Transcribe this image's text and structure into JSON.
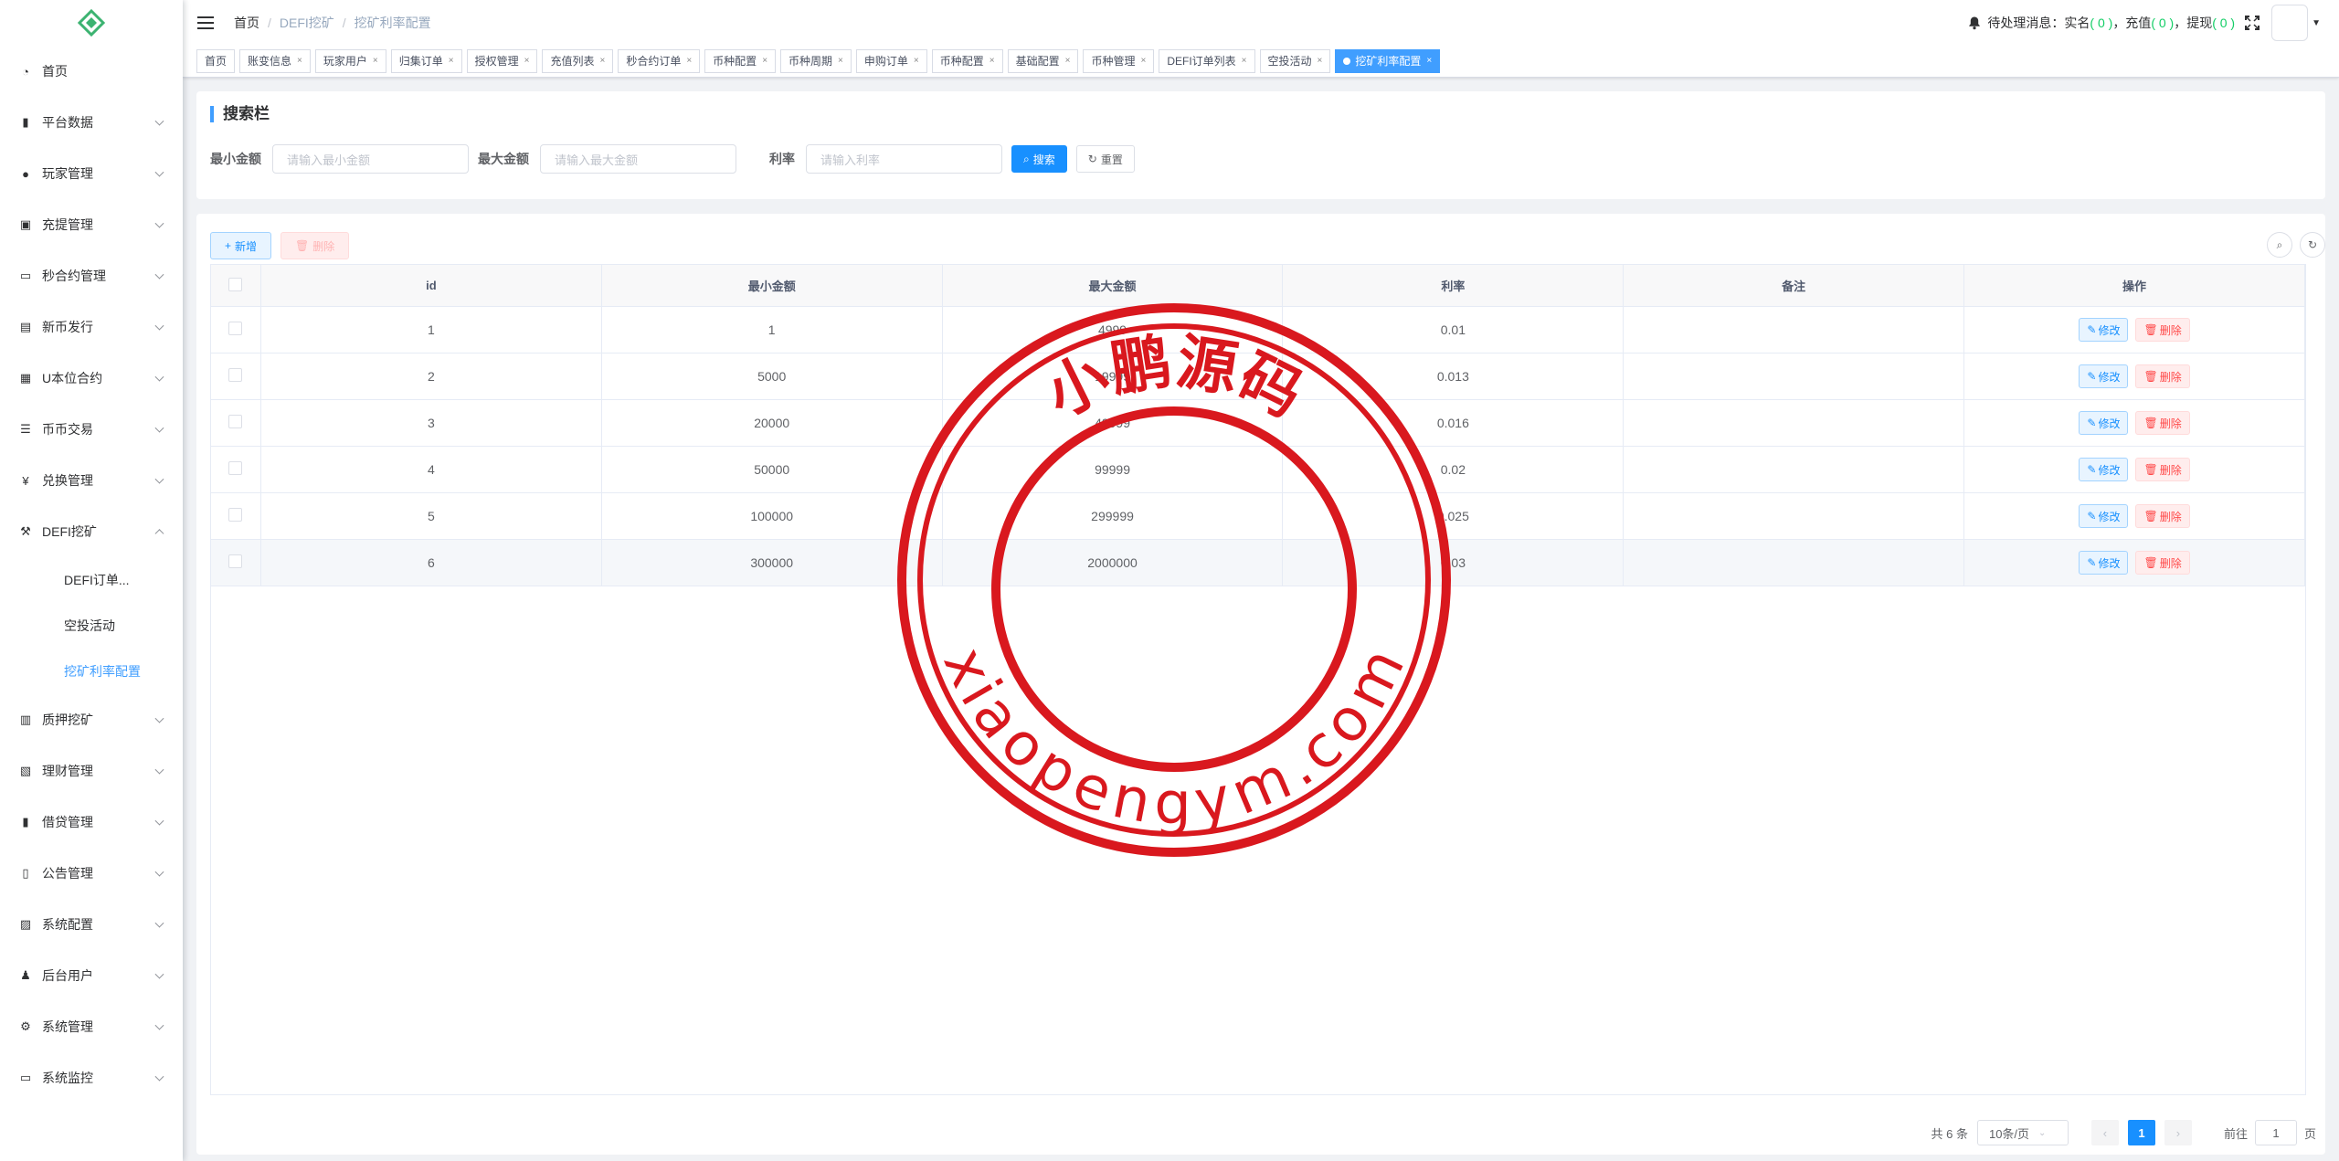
{
  "sidebar": {
    "items": [
      {
        "label": "首页",
        "icon": "dashboard-icon",
        "expandable": false
      },
      {
        "label": "平台数据",
        "icon": "chart-icon",
        "expandable": true
      },
      {
        "label": "玩家管理",
        "icon": "user-icon",
        "expandable": true
      },
      {
        "label": "充提管理",
        "icon": "wallet-icon",
        "expandable": true
      },
      {
        "label": "秒合约管理",
        "icon": "monitor-icon",
        "expandable": true
      },
      {
        "label": "新币发行",
        "icon": "coin-icon",
        "expandable": true
      },
      {
        "label": "U本位合约",
        "icon": "grid-icon",
        "expandable": true
      },
      {
        "label": "币币交易",
        "icon": "list-icon",
        "expandable": true
      },
      {
        "label": "兑换管理",
        "icon": "yen-icon",
        "expandable": true
      },
      {
        "label": "DEFI挖矿",
        "icon": "mining-icon",
        "expandable": true,
        "open": true
      }
    ],
    "sub_items": [
      {
        "label": "DEFI订单..."
      },
      {
        "label": "空投活动"
      },
      {
        "label": "挖矿利率配置",
        "active": true
      }
    ],
    "items_after": [
      {
        "label": "质押挖矿",
        "icon": "bar-chart-icon"
      },
      {
        "label": "理财管理",
        "icon": "finance-icon"
      },
      {
        "label": "借贷管理",
        "icon": "loan-icon"
      },
      {
        "label": "公告管理",
        "icon": "book-icon"
      },
      {
        "label": "系统配置",
        "icon": "config-icon"
      },
      {
        "label": "后台用户",
        "icon": "users-icon"
      },
      {
        "label": "系统管理",
        "icon": "gear-icon"
      },
      {
        "label": "系统监控",
        "icon": "monitor-icon"
      }
    ]
  },
  "navbar": {
    "breadcrumb": [
      "首页",
      "DEFI挖矿",
      "挖矿利率配置"
    ],
    "notice_prefix": "待处理消息：实名",
    "notice_real": "( 0 )",
    "notice_recharge_label": "，充值",
    "notice_recharge": "( 0 )",
    "notice_withdraw_label": "，提现",
    "notice_withdraw": "( 0 )"
  },
  "tags": [
    "首页",
    "账变信息",
    "玩家用户",
    "归集订单",
    "授权管理",
    "充值列表",
    "秒合约订单",
    "币种配置",
    "币种周期",
    "申购订单",
    "币种配置",
    "基础配置",
    "币种管理",
    "DEFI订单列表",
    "空投活动"
  ],
  "active_tag": "挖矿利率配置",
  "search": {
    "title": "搜索栏",
    "min_label": "最小金额",
    "min_placeholder": "请输入最小金额",
    "max_label": "最大金额",
    "max_placeholder": "请输入最大金额",
    "rate_label": "利率",
    "rate_placeholder": "请输入利率",
    "search_btn": "搜索",
    "reset_btn": "重置"
  },
  "toolbar": {
    "add_label": "新增",
    "delete_label": "删除"
  },
  "table": {
    "headers": [
      "id",
      "最小金额",
      "最大金额",
      "利率",
      "备注",
      "操作"
    ],
    "edit_label": "修改",
    "delete_label": "删除",
    "rows": [
      {
        "id": "1",
        "min": "1",
        "max": "4999",
        "rate": "0.01",
        "note": ""
      },
      {
        "id": "2",
        "min": "5000",
        "max": "19999",
        "rate": "0.013",
        "note": ""
      },
      {
        "id": "3",
        "min": "20000",
        "max": "49999",
        "rate": "0.016",
        "note": ""
      },
      {
        "id": "4",
        "min": "50000",
        "max": "99999",
        "rate": "0.02",
        "note": ""
      },
      {
        "id": "5",
        "min": "100000",
        "max": "299999",
        "rate": "0.025",
        "note": ""
      },
      {
        "id": "6",
        "min": "300000",
        "max": "2000000",
        "rate": "0.03",
        "note": ""
      }
    ]
  },
  "pagination": {
    "total": "共 6 条",
    "page_size": "10条/页",
    "current": "1",
    "goto_label": "前往",
    "goto_value": "1",
    "goto_suffix": "页"
  },
  "watermark": {
    "top_text": "小鹏源码",
    "bottom_text": "xiaopengym.com",
    "color": "#d9181e"
  }
}
